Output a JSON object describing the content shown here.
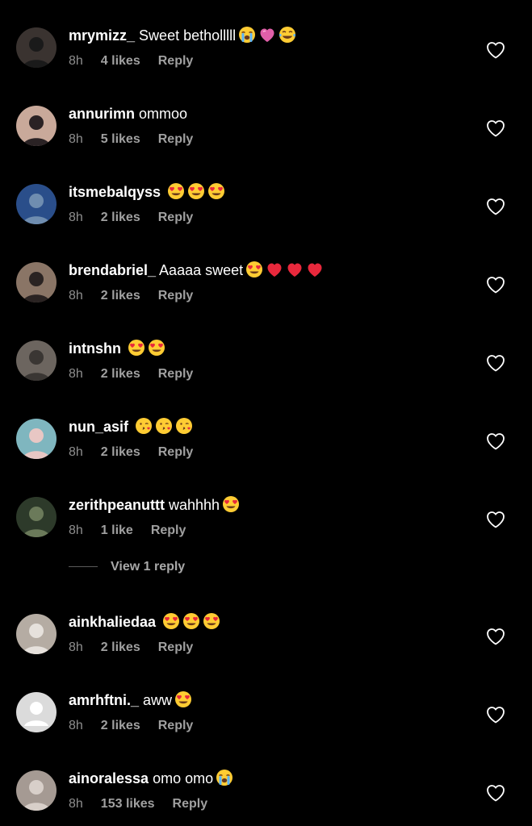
{
  "colors": {
    "background": "#000000",
    "text": "#ffffff",
    "meta": "#8e8e8e",
    "divider": "#5a5a5a"
  },
  "comments": [
    {
      "username": "mrymizz_",
      "text": "Sweet betholllll",
      "emojis": [
        "loudly-crying",
        "pink-heart",
        "tears-of-joy"
      ],
      "time": "8h",
      "likes": "4 likes",
      "reply": "Reply",
      "avatar": [
        "#3a3330",
        "#1a1a1a"
      ]
    },
    {
      "username": "annurimn",
      "text": "ommoo",
      "emojis": [],
      "time": "8h",
      "likes": "5 likes",
      "reply": "Reply",
      "avatar": [
        "#c9a99a",
        "#2a2224"
      ]
    },
    {
      "username": "itsmebalqyss",
      "text": "",
      "emojis": [
        "heart-eyes",
        "heart-eyes",
        "heart-eyes"
      ],
      "time": "8h",
      "likes": "2 likes",
      "reply": "Reply",
      "avatar": [
        "#2a4e8a",
        "#6f8db0"
      ]
    },
    {
      "username": "brendabriel_",
      "text": "Aaaaa sweet",
      "emojis": [
        "heart-eyes",
        "red-heart",
        "red-heart",
        "red-heart"
      ],
      "time": "8h",
      "likes": "2 likes",
      "reply": "Reply",
      "avatar": [
        "#8a7566",
        "#2a2322"
      ]
    },
    {
      "username": "intnshn",
      "text": "",
      "emojis": [
        "heart-eyes",
        "heart-eyes"
      ],
      "time": "8h",
      "likes": "2 likes",
      "reply": "Reply",
      "avatar": [
        "#6c655f",
        "#3a3633"
      ]
    },
    {
      "username": "nun_asif",
      "text": "",
      "emojis": [
        "kissing-heart",
        "kissing-heart",
        "kissing-heart"
      ],
      "time": "8h",
      "likes": "2 likes",
      "reply": "Reply",
      "avatar": [
        "#7fb6bf",
        "#e8c7c4"
      ]
    },
    {
      "username": "zerithpeanuttt",
      "text": "wahhhh",
      "emojis": [
        "heart-eyes"
      ],
      "time": "8h",
      "likes": "1 like",
      "reply": "Reply",
      "avatar": [
        "#2d3a2a",
        "#6b7a5a"
      ]
    },
    {
      "username": "ainkhaliedaa",
      "text": "",
      "emojis": [
        "heart-eyes",
        "heart-eyes",
        "heart-eyes"
      ],
      "time": "8h",
      "likes": "2 likes",
      "reply": "Reply",
      "avatar": [
        "#b5aca3",
        "#e6e1dc"
      ]
    },
    {
      "username": "amrhftni._",
      "text": "aww",
      "emojis": [
        "heart-eyes"
      ],
      "time": "8h",
      "likes": "2 likes",
      "reply": "Reply",
      "avatar": [
        "#dbdbdb",
        "#ffffff"
      ]
    },
    {
      "username": "ainoralessa",
      "text": "omo omo",
      "emojis": [
        "loudly-crying"
      ],
      "time": "8h",
      "likes": "153 likes",
      "reply": "Reply",
      "avatar": [
        "#a59a93",
        "#d8cfc9"
      ]
    }
  ],
  "view_reply": "View 1 reply"
}
